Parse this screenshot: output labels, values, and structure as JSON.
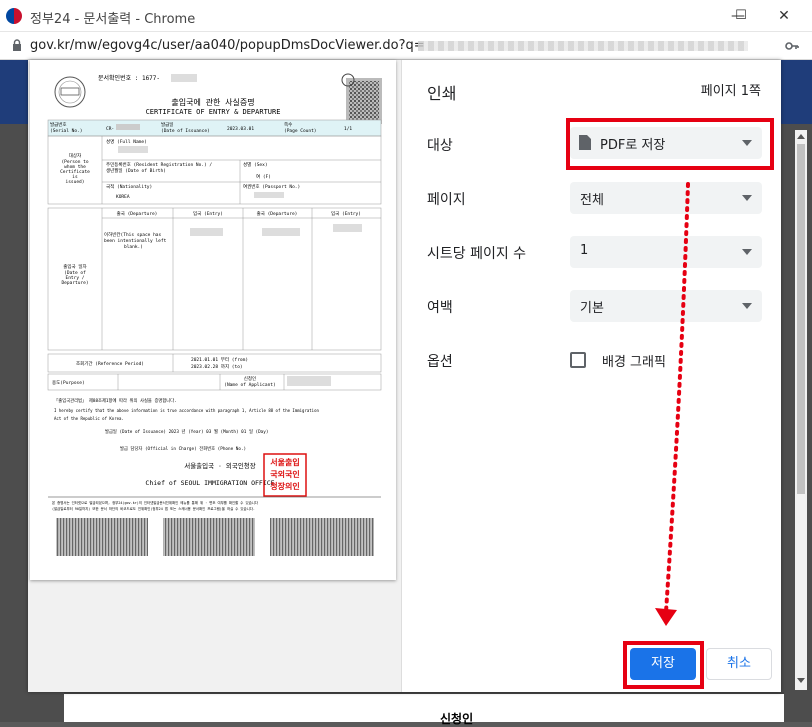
{
  "window": {
    "title": "정부24 - 문서출력 - Chrome",
    "minimize": "—",
    "maximize": "☐",
    "close": "✕"
  },
  "address": {
    "url": "gov.kr/mw/egovg4c/user/aa040/popupDmsDocViewer.do?q="
  },
  "background": {
    "bottom_label": "신청인"
  },
  "print": {
    "title": "인쇄",
    "page_count": "페이지 1쪽",
    "destination_label": "대상",
    "destination_value": "PDF로 저장",
    "pages_label": "페이지",
    "pages_value": "전체",
    "pages_per_sheet_label": "시트당 페이지 수",
    "pages_per_sheet_value": "1",
    "margins_label": "여백",
    "margins_value": "기본",
    "options_label": "옵션",
    "background_graphics_label": "배경 그래픽",
    "save_label": "저장",
    "cancel_label": "취소"
  },
  "document": {
    "doc_number_label": "문서확인번호 : 1677-",
    "title_ko": "출입국에 관한 사실증명",
    "title_en": "CERTIFICATE OF ENTRY & DEPARTURE",
    "serial_label": "발급번호",
    "serial_en": "(Serial No.)",
    "serial_value": "CR-",
    "issue_date_label": "발급일",
    "issue_date_en": "(Date of Issuance)",
    "issue_date_value": "2023.03.01",
    "page_label": "쪽수",
    "page_en": "(Page Count)",
    "page_value": "1/1",
    "subject_label": "대상자",
    "subject_en_1": "(Person to",
    "subject_en_2": "whom the",
    "subject_en_3": "Certificate",
    "subject_en_4": "is",
    "subject_en_5": "issued)",
    "name_label": "성명 (Full Name)",
    "rrn_label": "주민등록번호 (Resident Registration No.) /",
    "dob_label": "생년월일 (Date of Birth)",
    "sex_label": "성별 (Sex)",
    "sex_value": "여 (F)",
    "nationality_label": "국적 (Nationality)",
    "nationality_value": "KOREA",
    "passport_label": "여권번호 (Passport No.)",
    "movement_label": "출입국 일자",
    "movement_en_1": "(Date of",
    "movement_en_2": "Entry /",
    "movement_en_3": "Departure)",
    "col_departure": "출국 (Departure)",
    "col_entry": "입국 (Entry)",
    "blank_note_1": "이하빈칸(This space has",
    "blank_note_2": "been intentionally left",
    "blank_note_3": "blank.)",
    "period_label": "조회기간 (Reference Period)",
    "period_from": "2021.01.01 부터 (from)",
    "period_to": "2023.02.28 까지 (to)",
    "purpose_label": "용도(Purpose)",
    "applicant_label": "신청인",
    "applicant_en": "(Name of Applicant)",
    "law_ko": "「출입국관리법」 제88조제1항에 따라 위의 사실을 증명합니다.",
    "law_en_1": "I hereby certify that the above information is true accordance with paragraph 1, Article 88 of the Immigration",
    "law_en_2": "Act of the Republic of Korea.",
    "issuance_line": "발급일 (Date of Issuance)      2023 년 (Year)  03 월 (Month)  01 일 (Day)",
    "officer_line": "발급 담당자 (Official in Charge)                 전화번호 (Phone No.)",
    "office_ko": "서울출입국 · 외국인청장",
    "office_en": "Chief of SEOUL IMMIGRATION OFFICE",
    "seal_text": "서울출입국외국인청장의인",
    "footer_note_1": "본 증명서는 인터넷으로 발급되었으며, 정부24(gov.kr)의 인터넷발급문서진위확인 메뉴를 통해 위 · 변조 여부를 확인할 수 있습니다",
    "footer_note_2": "(발급일로부터 90일까지) 또한 문서 하단의 바코드로도 진위확인(정부24 앱 또는 스캐너용 문서확인 프로그램)을 하실 수 있습니다."
  },
  "colors": {
    "red_highlight": "#e60012",
    "primary": "#1a73e8",
    "doc_header": "#dff3f6"
  }
}
